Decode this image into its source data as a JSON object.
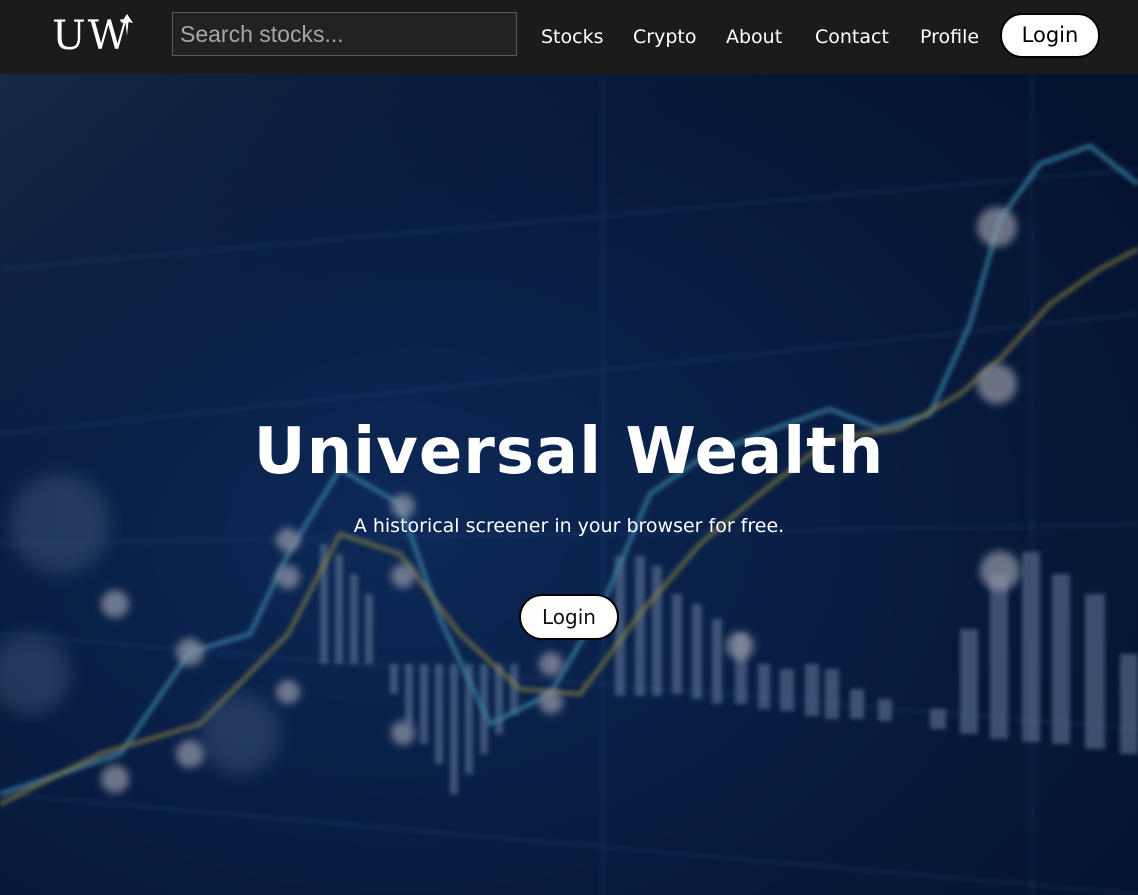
{
  "navbar": {
    "logo_text": "UW",
    "search": {
      "placeholder": "Search stocks...",
      "value": ""
    },
    "links": [
      {
        "label": "Stocks"
      },
      {
        "label": "Crypto"
      },
      {
        "label": "About"
      },
      {
        "label": "Contact"
      },
      {
        "label": "Profile"
      }
    ],
    "login_label": "Login"
  },
  "hero": {
    "title": "Universal Wealth",
    "subtitle": "A historical screener in your browser for free.",
    "login_label": "Login",
    "background_image": "blurred-stock-chart"
  },
  "colors": {
    "navbar_bg": "#1b1b1b",
    "hero_bg": "#0a1f45",
    "button_bg": "#ffffff",
    "text": "#ffffff"
  }
}
